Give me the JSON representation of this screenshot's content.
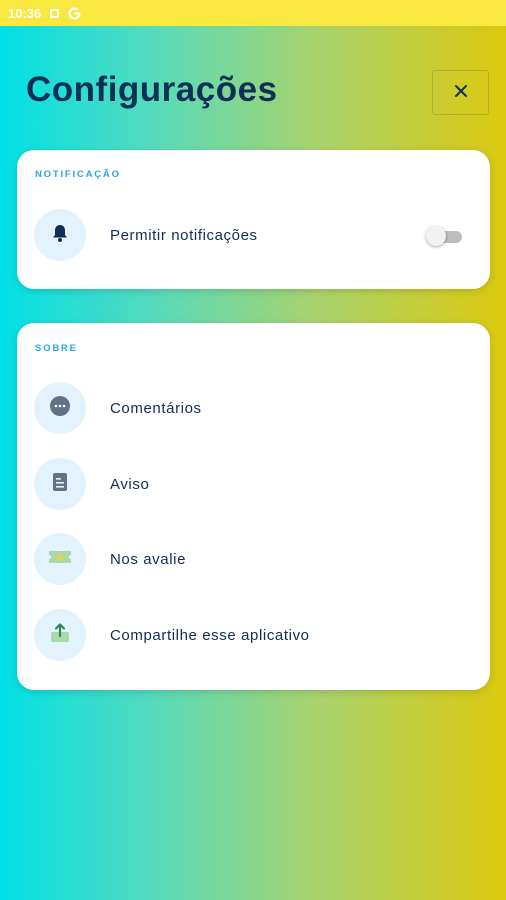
{
  "status_bar": {
    "time": "10:36"
  },
  "header": {
    "title": "Configurações",
    "close_icon": "close-icon"
  },
  "notifications_section": {
    "label": "NOTIFICAÇÃO",
    "items": [
      {
        "label": "Permitir notificações",
        "icon": "bell-icon",
        "toggle_on": false
      }
    ]
  },
  "about_section": {
    "label": "SOBRE",
    "items": [
      {
        "label": "Comentários",
        "icon": "chat-bubble-icon"
      },
      {
        "label": "Aviso",
        "icon": "document-icon"
      },
      {
        "label": "Nos avalie",
        "icon": "ticket-star-icon"
      },
      {
        "label": "Compartilhe esse aplicativo",
        "icon": "share-icon"
      }
    ]
  },
  "colors": {
    "gradient_start": "#00e0e6",
    "gradient_end": "#dcc90d",
    "title": "#0e2f56",
    "section_label": "#2aa6e6",
    "icon_bg": "#e2f3fd"
  }
}
